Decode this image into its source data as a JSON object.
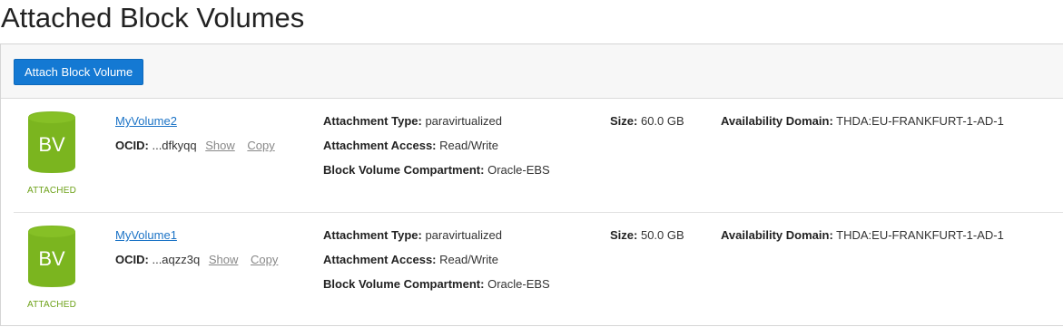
{
  "page": {
    "title": "Attached Block Volumes"
  },
  "toolbar": {
    "attach_label": "Attach Block Volume"
  },
  "labels": {
    "ocid": "OCID:",
    "show": "Show",
    "copy": "Copy",
    "attachment_type": "Attachment Type:",
    "attachment_access": "Attachment Access:",
    "compartment": "Block Volume Compartment:",
    "size": "Size:",
    "availability_domain": "Availability Domain:"
  },
  "colors": {
    "accent": "#1479d3",
    "badge_green": "#6ea21a",
    "link": "#1b73c6"
  },
  "volumes": [
    {
      "icon_text": "BV",
      "status": "ATTACHED",
      "name": "MyVolume2",
      "ocid_short": "...dfkyqq",
      "attachment_type": "paravirtualized",
      "attachment_access": "Read/Write",
      "compartment": "Oracle-EBS",
      "size": "60.0 GB",
      "availability_domain": "THDA:EU-FRANKFURT-1-AD-1"
    },
    {
      "icon_text": "BV",
      "status": "ATTACHED",
      "name": "MyVolume1",
      "ocid_short": "...aqzz3q",
      "attachment_type": "paravirtualized",
      "attachment_access": "Read/Write",
      "compartment": "Oracle-EBS",
      "size": "50.0 GB",
      "availability_domain": "THDA:EU-FRANKFURT-1-AD-1"
    }
  ]
}
